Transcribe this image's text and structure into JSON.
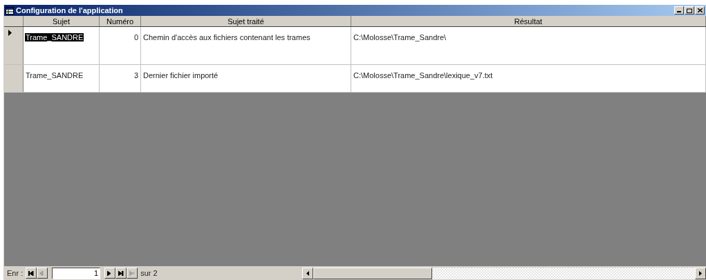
{
  "window": {
    "title": "Configuration de l'application"
  },
  "table": {
    "columns": [
      "Sujet",
      "Numéro",
      "Sujet traité",
      "Résultat"
    ],
    "rows": [
      {
        "current": true,
        "selected": true,
        "cells": [
          "Trame_SANDRE",
          "0",
          "Chemin d'accès aux fichiers contenant les trames",
          "C:\\Molosse\\Trame_Sandre\\"
        ]
      },
      {
        "current": false,
        "selected": false,
        "cells": [
          "Trame_SANDRE",
          "3",
          "Dernier fichier importé",
          "C:\\Molosse\\Trame_Sandre\\lexique_v7.txt"
        ]
      }
    ]
  },
  "navigation": {
    "label": "Enr :",
    "record": "1",
    "total": "sur 2",
    "buttons": [
      {
        "kind": "first",
        "disabled": false
      },
      {
        "kind": "prev",
        "disabled": true
      }
    ],
    "buttons_after": [
      {
        "kind": "next",
        "disabled": false
      },
      {
        "kind": "last",
        "disabled": false
      },
      {
        "kind": "new",
        "disabled": true
      }
    ]
  }
}
